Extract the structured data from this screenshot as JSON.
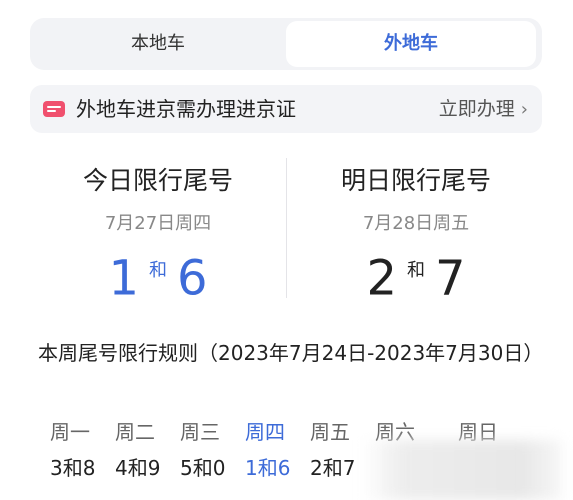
{
  "tabs": {
    "local": "本地车",
    "outside": "外地车"
  },
  "banner": {
    "icon": "ticket-icon",
    "text": "外地车进京需办理进京证",
    "action": "立即办理",
    "chevron": "›"
  },
  "today": {
    "title": "今日限行尾号",
    "date": "7月27日周四",
    "num1": "1",
    "he": "和",
    "num2": "6"
  },
  "tomorrow": {
    "title": "明日限行尾号",
    "date": "7月28日周五",
    "num1": "2",
    "he": "和",
    "num2": "7"
  },
  "week": {
    "title": "本周尾号限行规则（2023年7月24日-2023年7月30日）",
    "days": [
      "周一",
      "周二",
      "周三",
      "周四",
      "周五",
      "周六",
      "周日"
    ],
    "values": [
      "3和8",
      "4和9",
      "5和0",
      "1和6",
      "2和7",
      "",
      ""
    ]
  },
  "colors": {
    "accent": "#3d6bd8",
    "banner_icon": "#f0506e"
  }
}
